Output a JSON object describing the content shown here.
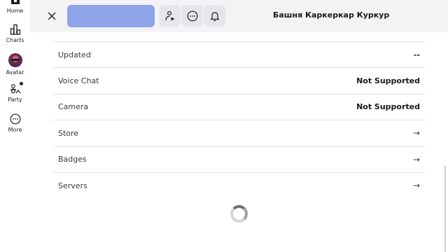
{
  "nav": {
    "items": [
      {
        "label": "Home",
        "icon": "home-icon"
      },
      {
        "label": "Charts",
        "icon": "charts-icon"
      },
      {
        "label": "Avatar",
        "icon": "avatar-icon"
      },
      {
        "label": "Party",
        "icon": "party-icon"
      },
      {
        "label": "More",
        "icon": "more-icon"
      }
    ]
  },
  "header": {
    "title": "Башня Каркеркар Куркур",
    "accent_color": "#8ea3e8",
    "buttons": [
      "close-icon",
      "play-with-friend-icon",
      "options-icon",
      "notification-bell-icon"
    ]
  },
  "details": {
    "rows": [
      {
        "label": "Updated",
        "value": "--"
      },
      {
        "label": "Voice Chat",
        "value": "Not Supported"
      },
      {
        "label": "Camera",
        "value": "Not Supported"
      },
      {
        "label": "Store",
        "arrow": "→"
      },
      {
        "label": "Badges",
        "arrow": "→"
      },
      {
        "label": "Servers",
        "arrow": "→"
      }
    ]
  }
}
